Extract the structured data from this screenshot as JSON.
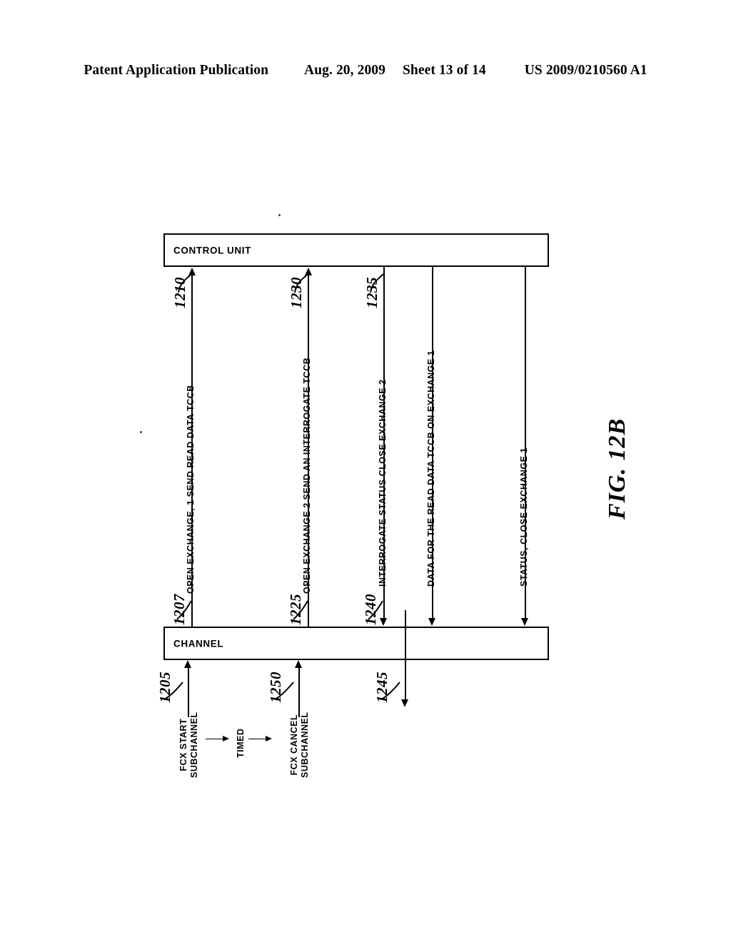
{
  "header": {
    "publication": "Patent Application Publication",
    "date": "Aug. 20, 2009",
    "sheet": "Sheet 13 of 14",
    "patent_number": "US 2009/0210560 A1"
  },
  "figure": {
    "caption": "FIG.  12B"
  },
  "nodes": {
    "control_unit": "CONTROL UNIT",
    "channel": "CHANNEL"
  },
  "messages": [
    {
      "id": "msg-1207-1210",
      "text": "OPEN EXCHANGE, 1 SEND READ DATA TCCB",
      "direction": "up",
      "from_ref": "1207",
      "to_ref": "1210"
    },
    {
      "id": "msg-1225-1230",
      "text": "OPEN EXCHANGE 2 SEND AN INTERROGATE TCCB",
      "direction": "up",
      "from_ref": "1225",
      "to_ref": "1230"
    },
    {
      "id": "msg-1235-1240",
      "text": "INTERROGATE STATUS CLOSE EXCHANGE 2",
      "direction": "down",
      "from_ref": "1235",
      "to_ref": "1240"
    },
    {
      "id": "msg-data-exchange-1",
      "text": "DATA FOR THE READ DATA TCCB ON EXCHANGE 1",
      "direction": "down",
      "from_ref": "",
      "to_ref": ""
    },
    {
      "id": "msg-status-close-exchange-1",
      "text": "STATUS, CLOSE EXCHANGE 1",
      "direction": "down",
      "from_ref": "",
      "to_ref": ""
    }
  ],
  "reference_numerals": {
    "top": [
      "1210",
      "1230",
      "1235"
    ],
    "bottom": [
      "1207",
      "1225",
      "1240"
    ],
    "lower": [
      "1205",
      "1250",
      "1245"
    ]
  },
  "host_actions": {
    "start": "FCX START SUBCHANNEL",
    "start_line1": "FCX START",
    "start_line2": "SUBCHANNEL",
    "middle": "TIMED",
    "cancel": "FCX CANCEL SUBCHANNEL",
    "cancel_line1": "FCX CANCEL",
    "cancel_line2": "SUBCHANNEL"
  },
  "colors": {
    "ink": "#000000",
    "paper": "#ffffff"
  }
}
